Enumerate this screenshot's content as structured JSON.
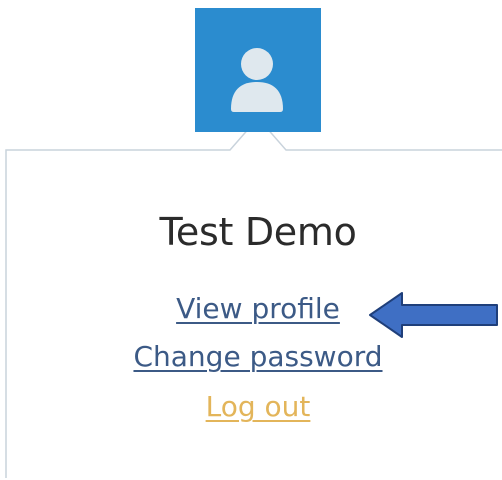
{
  "user": {
    "name": "Test Demo"
  },
  "menu": {
    "view_profile": "View profile",
    "change_password": "Change password",
    "log_out": "Log out"
  },
  "icons": {
    "avatar": "user-icon",
    "callout": "arrow-left-icon"
  },
  "colors": {
    "avatar_bg": "#2b8ccf",
    "link": "#3c5a86",
    "logout_link": "#e3b55a",
    "arrow_fill": "#3f6fc4",
    "arrow_stroke": "#1f3f7a"
  }
}
